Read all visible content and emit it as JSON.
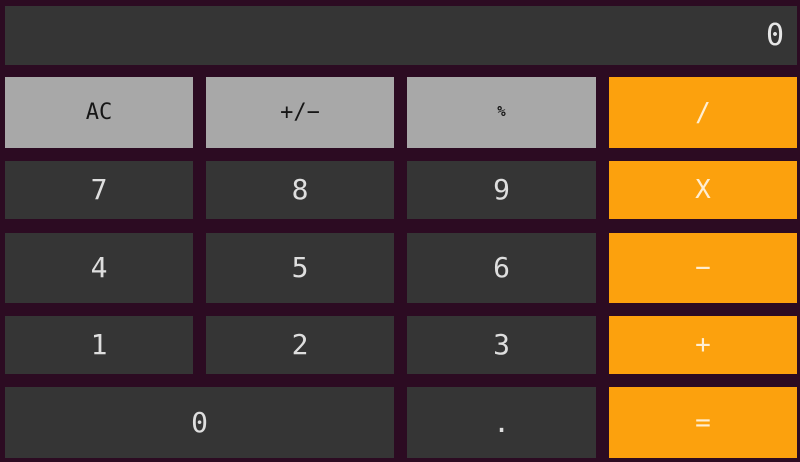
{
  "display": {
    "value": "0"
  },
  "keys": {
    "clear": "AC",
    "sign": "+/−",
    "percent": "%",
    "divide": "/",
    "seven": "7",
    "eight": "8",
    "nine": "9",
    "multiply": "X",
    "four": "4",
    "five": "5",
    "six": "6",
    "minus": "−",
    "one": "1",
    "two": "2",
    "three": "3",
    "plus": "+",
    "zero": "0",
    "decimal": ".",
    "equals": "="
  },
  "colors": {
    "background": "#2c0b22",
    "display": "#353535",
    "number_key": "#353535",
    "function_key": "#a8a8a8",
    "operator_key": "#fca10d"
  }
}
